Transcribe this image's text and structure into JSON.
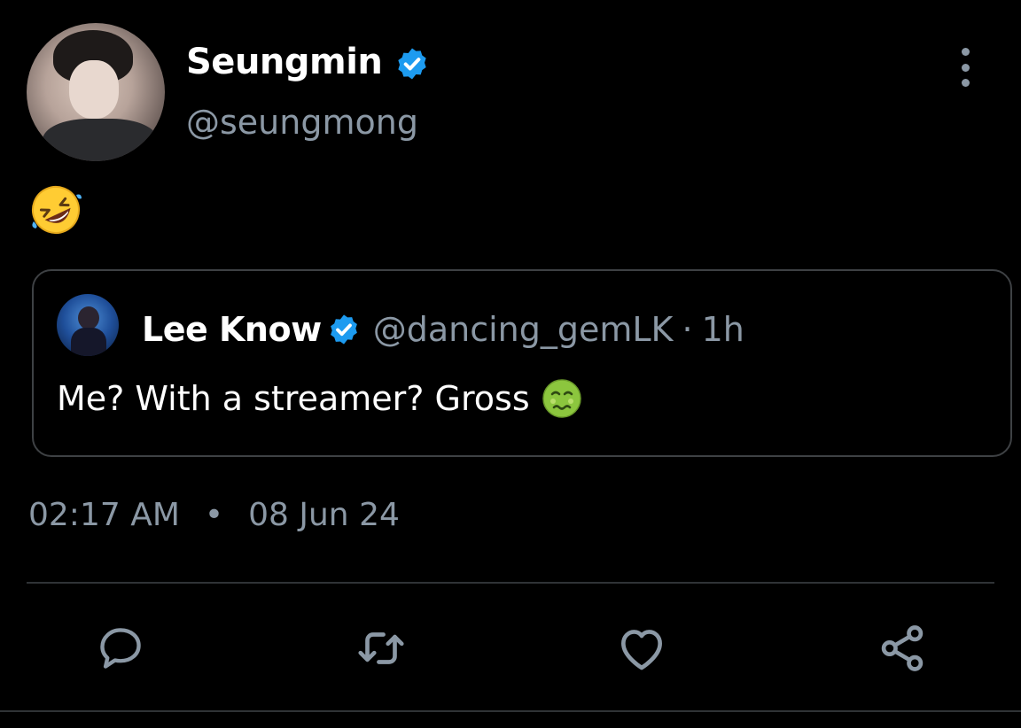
{
  "tweet": {
    "author": {
      "name": "Seungmin",
      "handle": "@seungmong",
      "verified": true,
      "avatar": "profile-photo"
    },
    "text_emoji": "rolling-on-the-floor-laughing",
    "quoted": {
      "author_name": "Lee Know",
      "author_handle": "@dancing_gemLK",
      "separator": "·",
      "time": "1h",
      "verified": true,
      "text": "Me? With a streamer? Gross",
      "text_emoji": "nauseated-face"
    },
    "timestamp": {
      "time": "02:17 AM",
      "separator": "•",
      "date": "08 Jun 24"
    }
  },
  "actions": [
    "reply-icon",
    "retweet-icon",
    "like-icon",
    "share-icon"
  ],
  "colors": {
    "background": "#000000",
    "primary_text": "#ffffff",
    "secondary_text": "#8b98a5",
    "verified": "#1d9bf0",
    "border": "#3e4144"
  }
}
